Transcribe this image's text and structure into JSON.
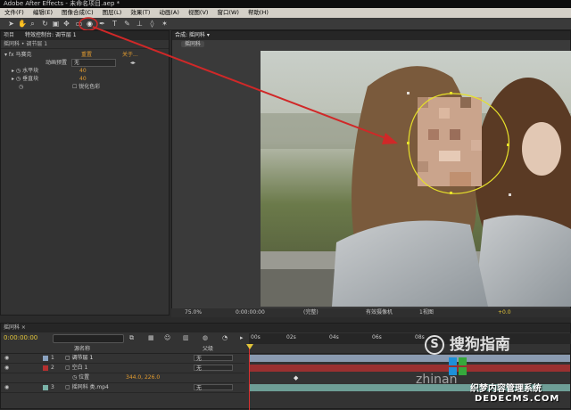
{
  "window": {
    "title": "Adobe After Effects - 未命名项目.aep *"
  },
  "menu": [
    "文件(F)",
    "编辑(E)",
    "图像合成(C)",
    "图层(L)",
    "效果(T)",
    "动画(A)",
    "视图(V)",
    "窗口(W)",
    "帮助(H)"
  ],
  "effects_panel": {
    "tabs": [
      "项目",
      "特效控制台: 调节层 1"
    ],
    "breadcrumb": "摇同科 • 调节层 1",
    "effect_name": "马赛克",
    "effect_reset": "重置",
    "effect_about": "关于...",
    "props": [
      {
        "name": "动画预置",
        "value": "无"
      },
      {
        "name": "水平块",
        "value": "40"
      },
      {
        "name": "垂直块",
        "value": "40"
      },
      {
        "name": "",
        "value": "锐化色彩"
      }
    ]
  },
  "composition_panel": {
    "tab": "合成: 摇同科 ▾",
    "subtab": "摇同科",
    "footer": {
      "zoom": "75.0%",
      "timecode": "0:00:00:00",
      "resolution": "(完整)",
      "camera": "有效摄像机",
      "views": "1视图",
      "offset": "+0.0"
    }
  },
  "timeline": {
    "tab": "摇同科 ×",
    "timecode": "0:00:00:00",
    "search_placeholder": "",
    "col_source": "源名称",
    "col_parent": "父级",
    "ruler": [
      "00s",
      "02s",
      "04s",
      "06s",
      "08s"
    ],
    "layers": [
      {
        "num": "1",
        "name": "调节层 1",
        "parent": "无",
        "color": "#8aa2c0"
      },
      {
        "num": "2",
        "name": "空白 1",
        "parent": "无",
        "color": "#b43030"
      },
      {
        "num": "",
        "name": "位置",
        "parent": "",
        "value": "344.0, 226.0",
        "color": ""
      },
      {
        "num": "3",
        "name": "摇同科 类.mp4",
        "parent": "无",
        "color": "#7ab2a8"
      }
    ]
  },
  "watermarks": {
    "sogou": "搜狗指南",
    "zhinan": "zhinan",
    "site_cn": "织梦内容管理系统",
    "site_url": "DEDECMS.COM"
  },
  "colors": {
    "mask": "#e6e02a",
    "arrow": "#d02828",
    "accent": "#e29b2f"
  }
}
